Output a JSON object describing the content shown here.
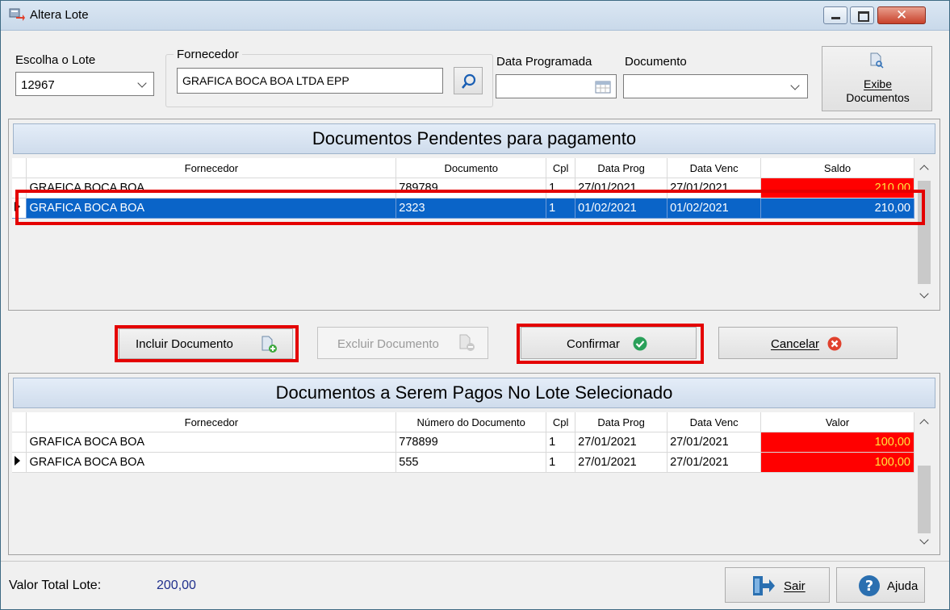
{
  "window": {
    "title": "Altera Lote"
  },
  "filters": {
    "lote_label": "Escolha o Lote",
    "lote_value": "12967",
    "fornecedor_label": "Fornecedor",
    "fornecedor_value": "GRAFICA BOCA BOA LTDA EPP",
    "data_label": "Data Programada",
    "data_value": "",
    "documento_label": "Documento",
    "documento_value": "",
    "exibe_label_1": "Exibe",
    "exibe_label_2": "Documentos"
  },
  "pending": {
    "title": "Documentos Pendentes para pagamento",
    "columns": [
      "Fornecedor",
      "Documento",
      "Cpl",
      "Data Prog",
      "Data Venc",
      "Saldo"
    ],
    "rows": [
      {
        "fornecedor": "GRAFICA BOCA BOA",
        "documento": "789789",
        "cpl": "1",
        "data_prog": "27/01/2021",
        "data_venc": "27/01/2021",
        "saldo": "210,00"
      },
      {
        "fornecedor": "GRAFICA BOCA BOA",
        "documento": "2323",
        "cpl": "1",
        "data_prog": "01/02/2021",
        "data_venc": "01/02/2021",
        "saldo": "210,00"
      }
    ]
  },
  "actions": {
    "incluir": "Incluir Documento",
    "excluir": "Excluir Documento",
    "confirmar": "Confirmar",
    "cancelar": "Cancelar"
  },
  "selected": {
    "title": "Documentos a Serem Pagos No Lote Selecionado",
    "columns": [
      "Fornecedor",
      "Número do Documento",
      "Cpl",
      "Data Prog",
      "Data Venc",
      "Valor"
    ],
    "rows": [
      {
        "fornecedor": "GRAFICA BOCA BOA",
        "documento": "778899",
        "cpl": "1",
        "data_prog": "27/01/2021",
        "data_venc": "27/01/2021",
        "valor": "100,00"
      },
      {
        "fornecedor": "GRAFICA BOCA BOA",
        "documento": "555",
        "cpl": "1",
        "data_prog": "27/01/2021",
        "data_venc": "27/01/2021",
        "valor": "100,00"
      }
    ]
  },
  "footer": {
    "total_label": "Valor Total Lote:",
    "total_value": "200,00",
    "sair": "Sair",
    "ajuda": "Ajuda"
  },
  "colors": {
    "selection": "#0a64c8",
    "money_bg": "#ff0000",
    "highlight": "#e40000"
  }
}
